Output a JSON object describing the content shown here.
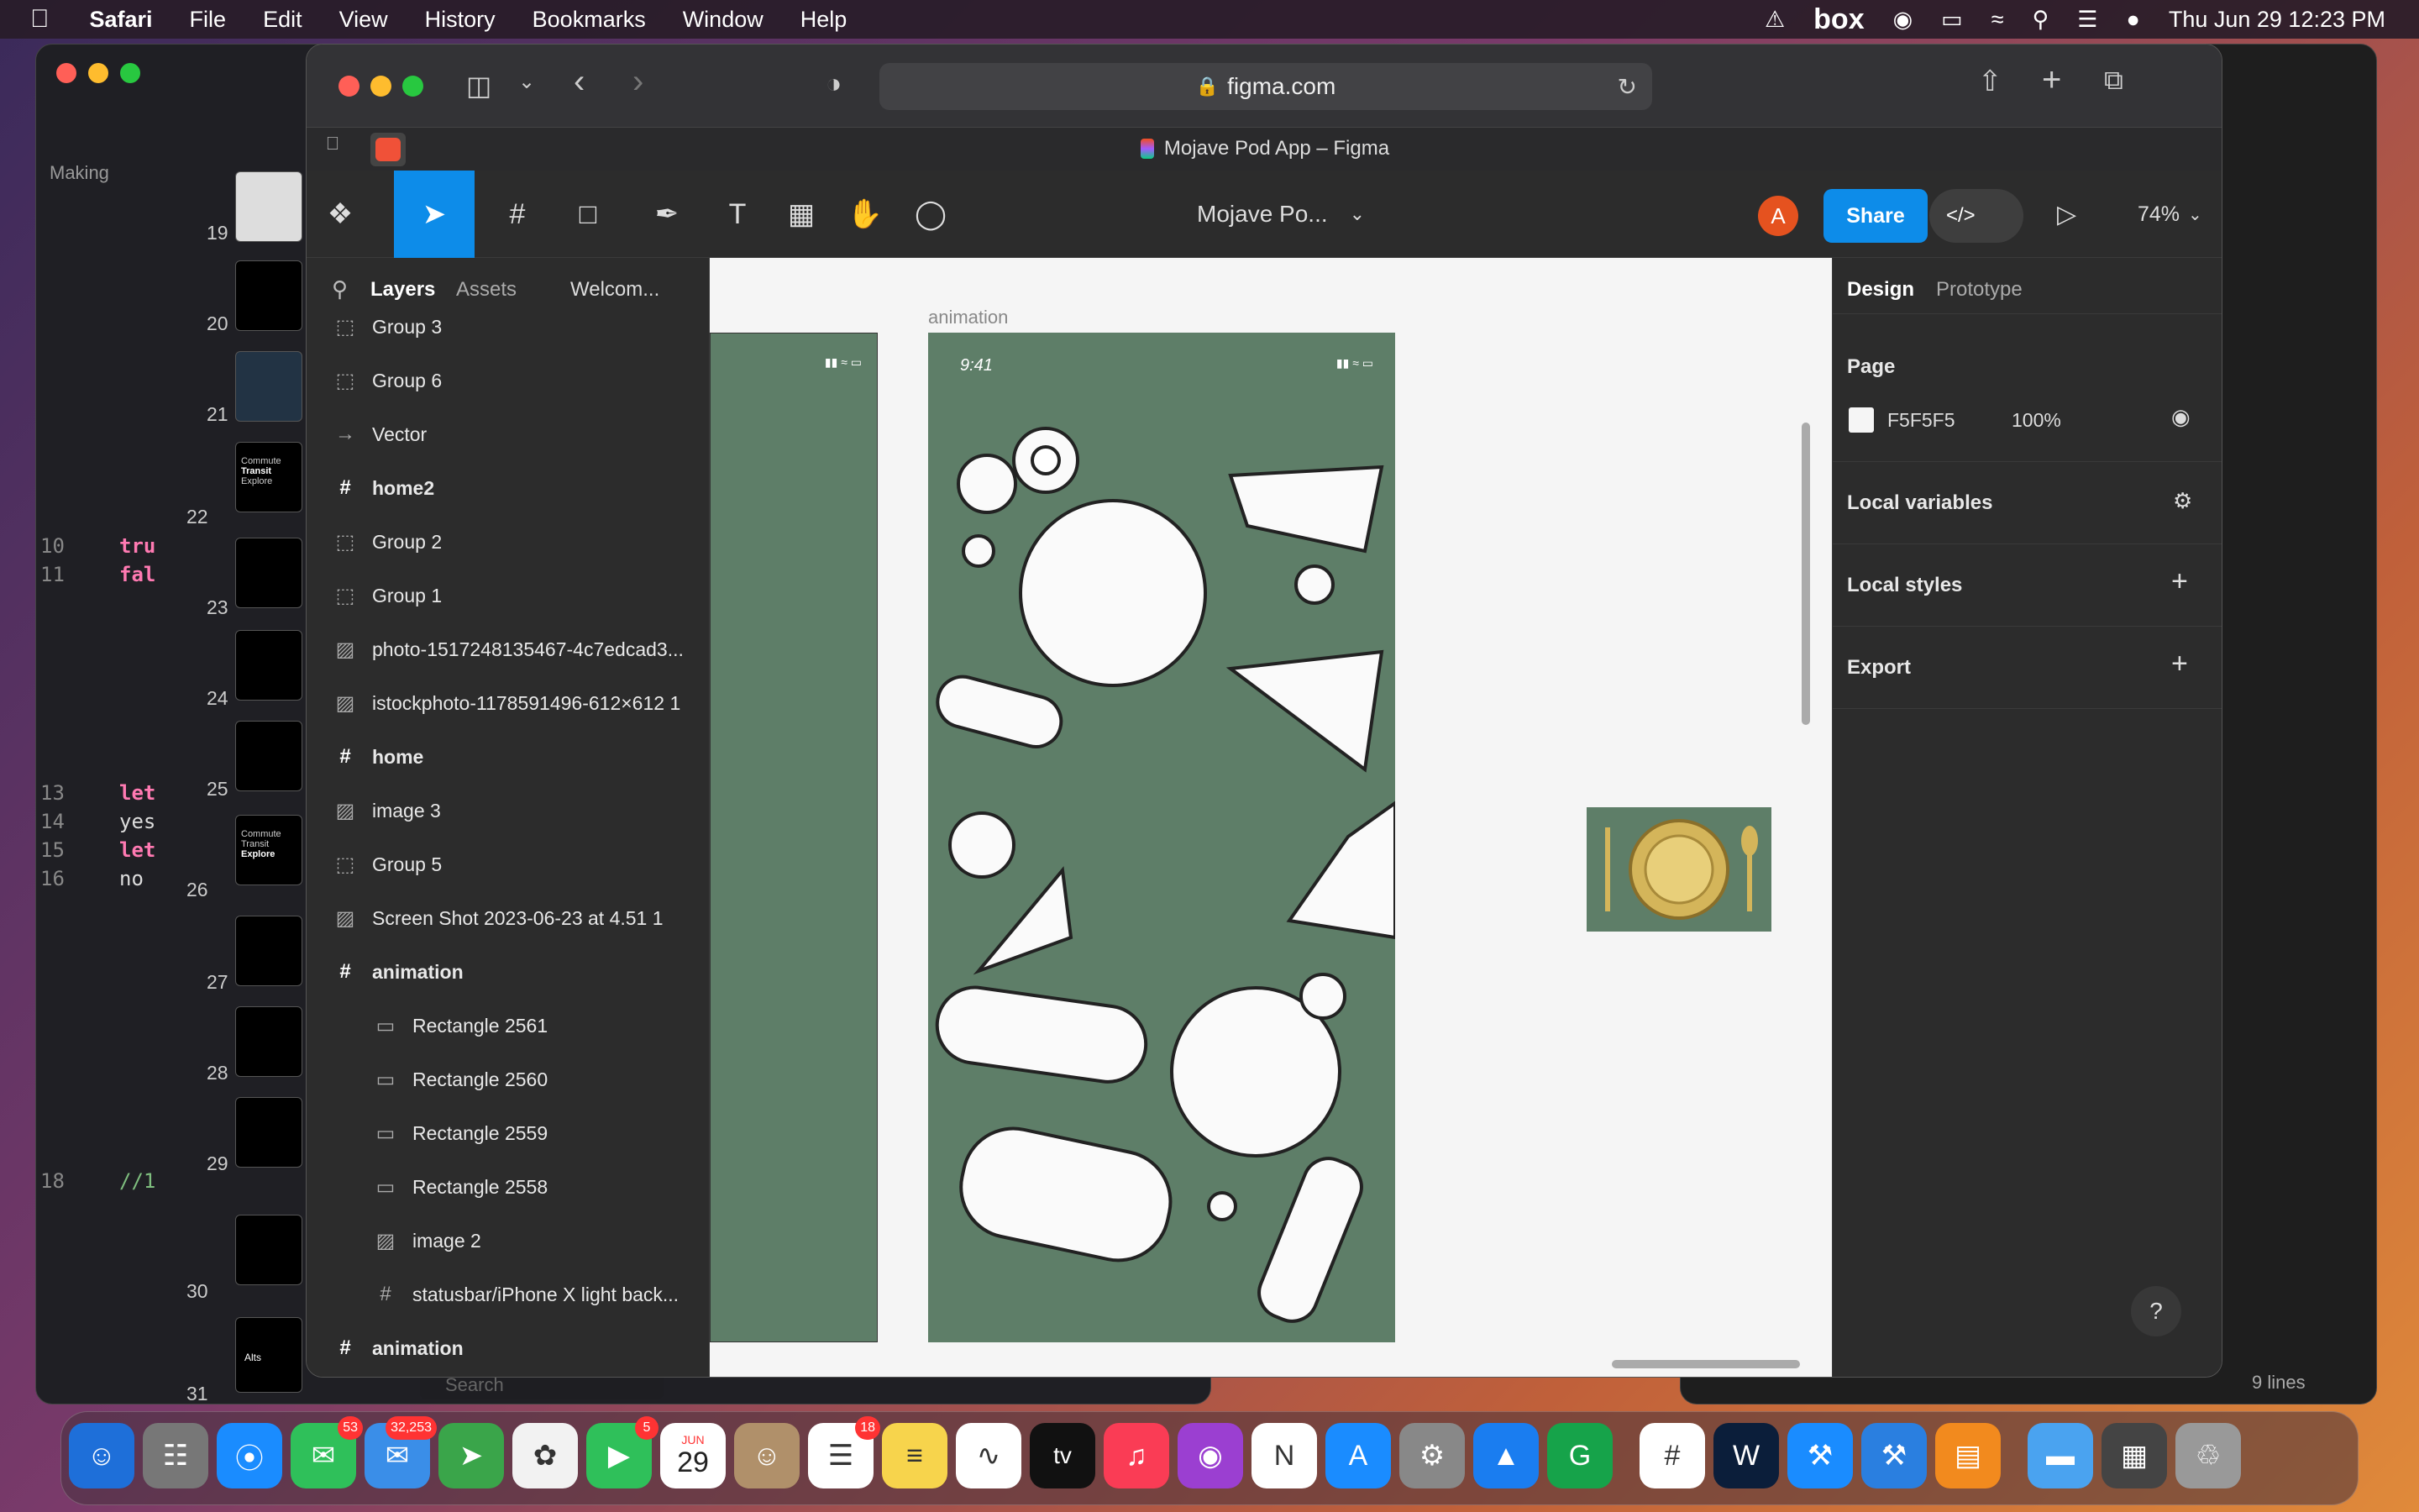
{
  "menubar": {
    "app_name": "Safari",
    "items": [
      "File",
      "Edit",
      "View",
      "History",
      "Bookmarks",
      "Window",
      "Help"
    ],
    "clock": "Thu Jun 29  12:23 PM",
    "box_label": "box"
  },
  "editor": {
    "tab_label": "Making",
    "lines": [
      {
        "num": "10",
        "code": "tru"
      },
      {
        "num": "11",
        "code": "fal"
      },
      {
        "num": "13",
        "code": "let"
      },
      {
        "num": "14",
        "code": "yes"
      },
      {
        "num": "15",
        "code": "let"
      },
      {
        "num": "16",
        "code": "no"
      },
      {
        "num": "18",
        "code": "//1"
      }
    ],
    "status_lines": "9 lines",
    "search_placeholder": "Search"
  },
  "thumbnails": {
    "numbers": [
      "19",
      "20",
      "21",
      "22",
      "23",
      "24",
      "25",
      "26",
      "27",
      "28",
      "29",
      "30",
      "31"
    ],
    "thumb22_lines": [
      "Commute",
      "Transit",
      "Explore"
    ],
    "thumb26_lines": [
      "Commute",
      "Transit",
      "Explore"
    ],
    "thumb31_label": "Alts"
  },
  "safari": {
    "url": "figma.com",
    "tab_title": "Mojave Pod App – Figma"
  },
  "figma": {
    "file_title": "Mojave Po...",
    "avatar_initial": "A",
    "share_label": "Share",
    "zoom": "74%",
    "panel_tabs": {
      "layers": "Layers",
      "assets": "Assets",
      "page": "Welcom..."
    },
    "layers": [
      {
        "name": "Group 3",
        "type": "group",
        "indent": 0
      },
      {
        "name": "Group 6",
        "type": "group",
        "indent": 0
      },
      {
        "name": "Vector",
        "type": "vector",
        "indent": 0
      },
      {
        "name": "home2",
        "type": "frame",
        "indent": 0
      },
      {
        "name": "Group 2",
        "type": "group",
        "indent": 0
      },
      {
        "name": "Group 1",
        "type": "group",
        "indent": 0
      },
      {
        "name": "photo-1517248135467-4c7edcad3...",
        "type": "image",
        "indent": 0
      },
      {
        "name": "istockphoto-1178591496-612×612 1",
        "type": "image",
        "indent": 0
      },
      {
        "name": "home",
        "type": "frame",
        "indent": 0
      },
      {
        "name": "image 3",
        "type": "image",
        "indent": 0
      },
      {
        "name": "Group 5",
        "type": "group",
        "indent": 0
      },
      {
        "name": "Screen Shot 2023-06-23 at 4.51 1",
        "type": "image",
        "indent": 0
      },
      {
        "name": "animation",
        "type": "frame",
        "indent": 0
      },
      {
        "name": "Rectangle 2561",
        "type": "rect",
        "indent": 1
      },
      {
        "name": "Rectangle 2560",
        "type": "rect",
        "indent": 1
      },
      {
        "name": "Rectangle 2559",
        "type": "rect",
        "indent": 1
      },
      {
        "name": "Rectangle 2558",
        "type": "rect",
        "indent": 1
      },
      {
        "name": "image 2",
        "type": "image",
        "indent": 1
      },
      {
        "name": "statusbar/iPhone X light back...",
        "type": "frame-small",
        "indent": 1
      },
      {
        "name": "animation",
        "type": "frame",
        "indent": 0
      }
    ],
    "canvas": {
      "frame_label": "animation",
      "status_time": "9:41",
      "background_color": "#5e7e68"
    },
    "design_panel": {
      "tabs": {
        "design": "Design",
        "prototype": "Prototype"
      },
      "page_heading": "Page",
      "page_color": "F5F5F5",
      "page_opacity": "100%",
      "local_variables": "Local variables",
      "local_styles": "Local styles",
      "export": "Export",
      "help": "?"
    }
  },
  "dock": {
    "badges": {
      "messages": "53",
      "mail": "32,253",
      "facetime": "5",
      "reminders": "18"
    },
    "calendar": {
      "month": "JUN",
      "day": "29"
    },
    "tv_label": "tv"
  }
}
